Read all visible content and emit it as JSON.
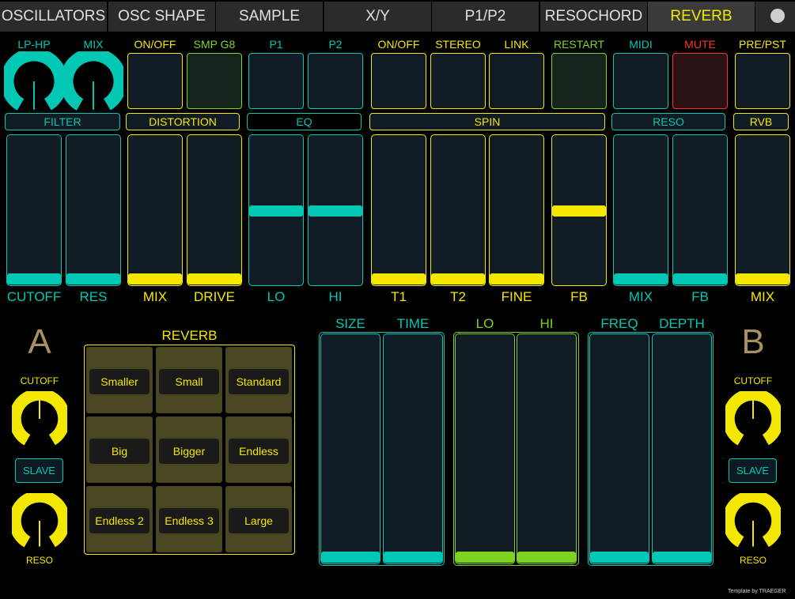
{
  "tabs": [
    "OSCILLATORS",
    "OSC SHAPE",
    "SAMPLE",
    "X/Y",
    "P1/P2",
    "RESOCHORD",
    "REVERB"
  ],
  "active_tab": 6,
  "colors": {
    "teal": "#00c8b4",
    "yellow": "#f5e800",
    "green": "#7ed321",
    "red": "#ff3030",
    "lightgreen": "#7ed321",
    "bronze": "#a89060"
  },
  "top": {
    "knob_labels": [
      "LP-HP",
      "MIX"
    ],
    "btn_labels": [
      "ON/OFF",
      "SMP G8",
      "P1",
      "P2",
      "ON/OFF",
      "STEREO",
      "LINK",
      "RESTART",
      "MIDI",
      "MUTE",
      "PRE/PST"
    ],
    "groups": [
      "FILTER",
      "DISTORTION",
      "EQ",
      "SPIN",
      "RESO",
      "RVB"
    ],
    "fader_labels": [
      "CUTOFF",
      "RES",
      "MIX",
      "DRIVE",
      "LO",
      "HI",
      "T1",
      "T2",
      "FINE",
      "FB",
      "MIX",
      "FB",
      "MIX"
    ],
    "fader_values": [
      0,
      0,
      0,
      0,
      0.5,
      0.5,
      0,
      0,
      0,
      0.5,
      0,
      0,
      0
    ]
  },
  "bottom": {
    "side_a": {
      "letter": "A",
      "knob1": "CUTOFF",
      "slave": "SLAVE",
      "knob2": "RESO"
    },
    "side_b": {
      "letter": "B",
      "knob1": "CUTOFF",
      "slave": "SLAVE",
      "knob2": "RESO"
    },
    "reverb_title": "REVERB",
    "presets": [
      "Smaller",
      "Small",
      "Standard",
      "Big",
      "Bigger",
      "Endless",
      "Endless 2",
      "Endless 3",
      "Large"
    ],
    "fader_labels": [
      "SIZE",
      "TIME",
      "LO",
      "HI",
      "FREQ",
      "DEPTH"
    ],
    "fader_values": [
      0,
      0,
      0,
      0,
      0,
      0
    ]
  },
  "credit": "Template by TRAEGER"
}
